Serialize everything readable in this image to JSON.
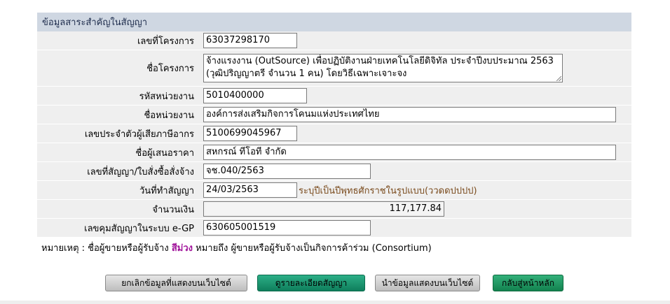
{
  "panel": {
    "title": "ข้อมูลสาระสำคัญในสัญญา",
    "rows": [
      {
        "label": "เลขที่โครงการ",
        "value": "63037298170"
      },
      {
        "label": "ชื่อโครงการ",
        "value_line1": "จ้างแรงงาน (OutSource) เพื่อปฏิบัติงานฝ่ายเทคโนโลยีดิจิทัล ประจำปีงบประมาณ 2563",
        "value_line2": "(วุฒิปริญญาตรี จำนวน 1 คน) โดยวิธีเฉพาะเจาะจง"
      },
      {
        "label": "รหัสหน่วยงาน",
        "value": "5010400000"
      },
      {
        "label": "ชื่อหน่วยงาน",
        "value": "องค์การส่งเสริมกิจการโคนมแห่งประเทศไทย"
      },
      {
        "label": "เลขประจำตัวผู้เสียภาษีอากร",
        "value": "5100699045967"
      },
      {
        "label": "ชื่อผู้เสนอราคา",
        "value": "สหกรณ์ ทีโอที จำกัด"
      },
      {
        "label": "เลขที่สัญญา/ใบสั่งซื้อสั่งจ้าง",
        "value": "จช.040/2563"
      },
      {
        "label": "วันที่ทำสัญญา",
        "value": "24/03/2563",
        "hint": "ระบุปีเป็นปีพุทธศักราชในรูปแบบ(ววดดปปปป)"
      },
      {
        "label": "จำนวนเงิน",
        "value": "117,177.84"
      },
      {
        "label": "เลขคุมสัญญาในระบบ e-GP",
        "value": "630605001519"
      }
    ]
  },
  "note": {
    "prefix": "หมายเหตุ : ชื่อผู้ขายหรือผู้รับจ้าง",
    "highlight": "สีม่วง",
    "suffix": "หมายถึง ผู้ขายหรือผู้รับจ้างเป็นกิจการค้าร่วม (Consortium)"
  },
  "buttons": {
    "cancel": "ยกเลิกข้อมูลที่แสดงบนเว็บไซต์",
    "details": "ดูรายละเอียดสัญญา",
    "publish": "นำข้อมูลแสดงบนเว็บไซต์",
    "back": "กลับสู่หน้าหลัก"
  }
}
